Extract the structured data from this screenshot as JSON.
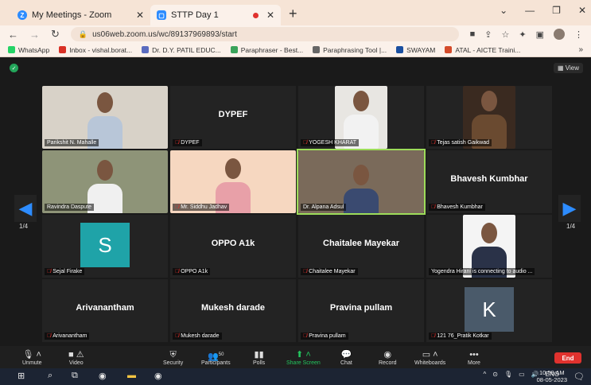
{
  "browser": {
    "tabs": [
      {
        "title": "My Meetings - Zoom",
        "icon": "zoom-icon"
      },
      {
        "title": "STTP Day 1",
        "icon": "zoom-icon"
      }
    ],
    "url": "us06web.zoom.us/wc/89137969893/start",
    "bookmarks": [
      {
        "label": "WhatsApp",
        "color": "#25d366"
      },
      {
        "label": "Inbox - vishal.borat...",
        "color": "#d93025"
      },
      {
        "label": "Dr. D.Y. PATIL EDUC...",
        "color": "#5a6bbf"
      },
      {
        "label": "Paraphraser - Best...",
        "color": "#3aa35a"
      },
      {
        "label": "Paraphrasing Tool |...",
        "color": "#666666"
      },
      {
        "label": "SWAYAM",
        "color": "#1a4fa0"
      },
      {
        "label": "ATAL - AICTE Traini...",
        "color": "#d44b2a"
      }
    ],
    "bookmarks_more": "»"
  },
  "meeting": {
    "view_label": "View",
    "page_left": "1/4",
    "page_right": "1/4",
    "participants": [
      {
        "name": "Parikshit N. Mahalle",
        "display": "",
        "muted": false,
        "video": true
      },
      {
        "name": "DYPEF",
        "display": "DYPEF",
        "muted": true,
        "video": false
      },
      {
        "name": "YOGESH KHARAT",
        "display": "",
        "muted": true,
        "video": true
      },
      {
        "name": "Tejas satish Gaikwad",
        "display": "",
        "muted": true,
        "video": true
      },
      {
        "name": "Ravindra Daspute",
        "display": "",
        "muted": false,
        "video": true
      },
      {
        "name": "Mr. Siddhu Jadhav",
        "display": "",
        "muted": true,
        "video": true
      },
      {
        "name": "Dr. Alpana Adsul",
        "display": "",
        "muted": false,
        "video": true
      },
      {
        "name": "Bhavesh Kumbhar",
        "display": "Bhavesh Kumbhar",
        "muted": true,
        "video": false
      },
      {
        "name": "Sejal Firake",
        "display": "S",
        "muted": true,
        "video": false
      },
      {
        "name": "OPPO A1k",
        "display": "OPPO A1k",
        "muted": true,
        "video": false
      },
      {
        "name": "Chaitalee Mayekar",
        "display": "Chaitalee Mayekar",
        "muted": true,
        "video": false
      },
      {
        "name": "Yogendra Hirani is connecting to audio ...",
        "display": "",
        "muted": false,
        "video": true
      },
      {
        "name": "Arivanantham",
        "display": "Arivanantham",
        "muted": true,
        "video": false
      },
      {
        "name": "Mukesh darade",
        "display": "Mukesh darade",
        "muted": true,
        "video": false
      },
      {
        "name": "Pravina pullam",
        "display": "Pravina pullam",
        "muted": true,
        "video": false
      },
      {
        "name": "121 76_Pratik Kotkar",
        "display": "K",
        "muted": true,
        "video": false
      }
    ]
  },
  "toolbar": {
    "unmute": "Unmute",
    "video": "Video",
    "security": "Security",
    "participants": "Participants",
    "participants_count": "50",
    "polls": "Polls",
    "share": "Share Screen",
    "chat": "Chat",
    "record": "Record",
    "whiteboards": "Whiteboards",
    "more": "More",
    "end": "End"
  },
  "taskbar": {
    "lang": "ENG",
    "time": "10:59 AM",
    "date": "08-05-2023"
  },
  "colors": {
    "accent": "#2d8cff",
    "end": "#e0322e",
    "share": "#23c55e",
    "active_speaker": "#9ddc5a"
  }
}
